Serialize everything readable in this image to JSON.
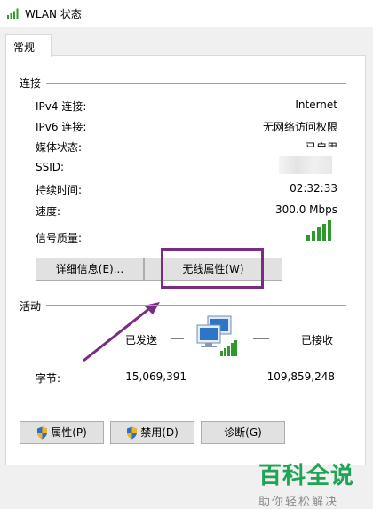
{
  "window": {
    "title": "WLAN 状态"
  },
  "tabs": [
    {
      "label": "常规"
    }
  ],
  "connection": {
    "section_label": "连接",
    "rows": [
      {
        "label": "IPv4 连接:",
        "value": "Internet"
      },
      {
        "label": "IPv6 连接:",
        "value": "无网络访问权限"
      },
      {
        "label": "媒体状态:",
        "value": "已启用"
      },
      {
        "label": "SSID:",
        "value": ""
      },
      {
        "label": "持续时间:",
        "value": "02:32:33"
      },
      {
        "label": "速度:",
        "value": "300.0 Mbps"
      }
    ],
    "signal_label": "信号质量:",
    "signal_bars": 5
  },
  "buttons": {
    "details": "详细信息(E)...",
    "wireless_props": "无线属性(W)",
    "properties": "属性(P)",
    "disable": "禁用(D)",
    "diagnose": "诊断(G)"
  },
  "activity": {
    "section_label": "活动",
    "sent_label": "已发送",
    "received_label": "已接收",
    "bytes_label": "字节:",
    "bytes_sent": "15,069,391",
    "bytes_received": "109,859,248"
  },
  "watermark": {
    "title": "百科全说",
    "subtitle": "助你轻松解决"
  },
  "colors": {
    "highlight": "#7a2b84",
    "signal": "#2e9a2e",
    "watermark": "#1fa355"
  }
}
